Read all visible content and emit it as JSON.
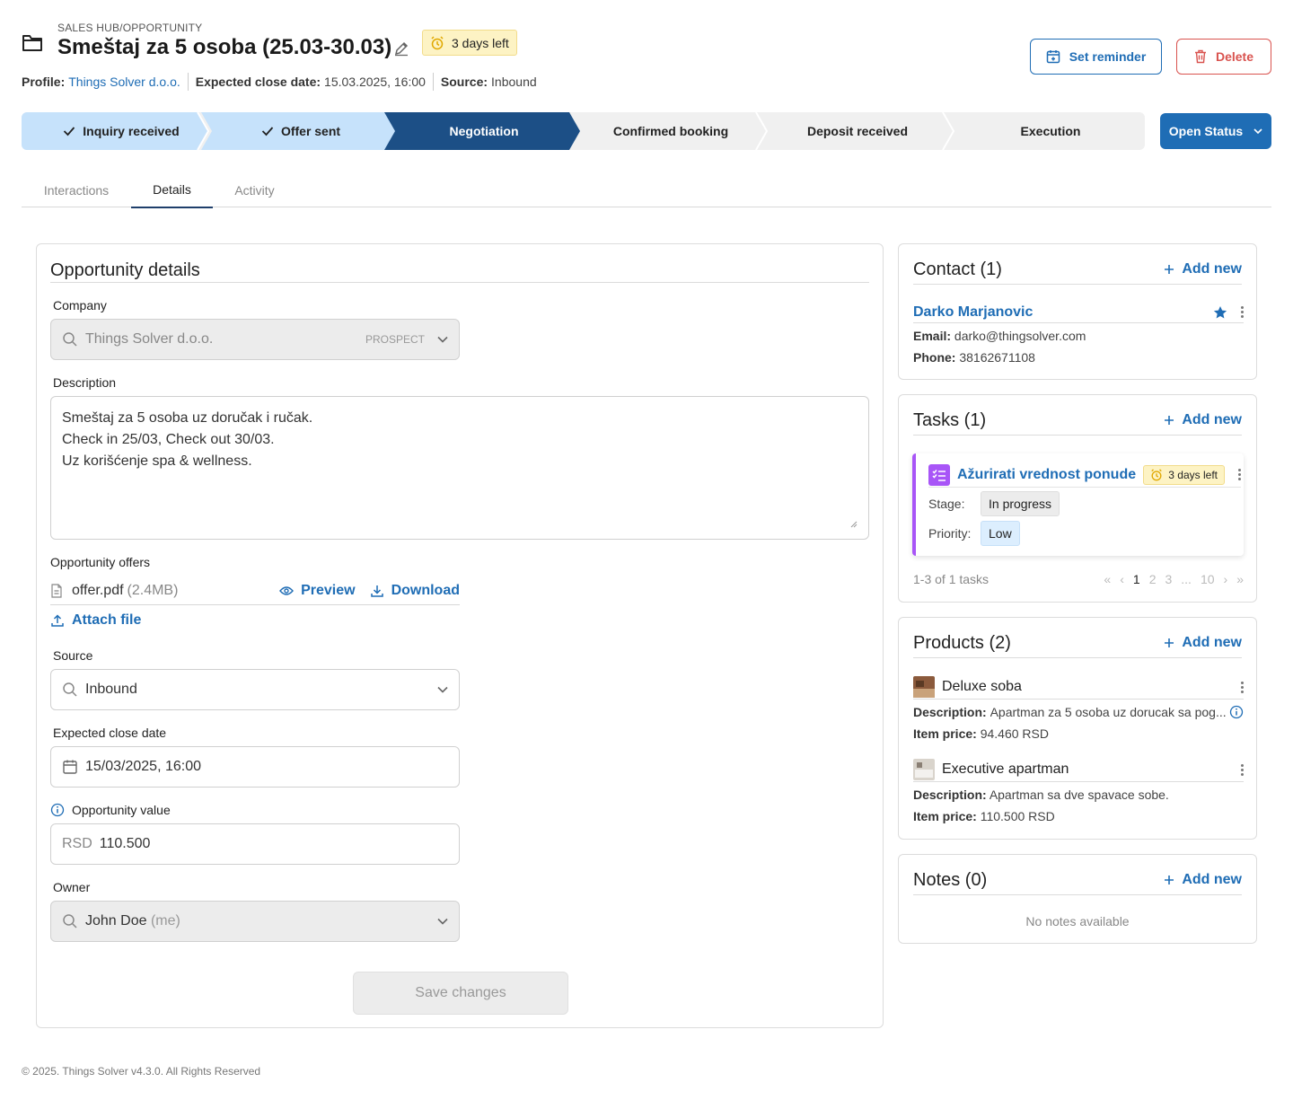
{
  "header": {
    "breadcrumb": "SALES HUB/OPPORTUNITY",
    "title": "Smeštaj za 5 osoba (25.03-30.03)",
    "days_left": "3 days left",
    "profile_label": "Profile:",
    "profile_value": "Things Solver d.o.o.",
    "close_label": "Expected close date:",
    "close_value": "15.03.2025, 16:00",
    "source_label": "Source:",
    "source_value": "Inbound",
    "set_reminder": "Set reminder",
    "delete": "Delete"
  },
  "pipeline": {
    "stages": [
      {
        "label": "Inquiry received",
        "state": "done"
      },
      {
        "label": "Offer sent",
        "state": "done"
      },
      {
        "label": "Negotiation",
        "state": "current"
      },
      {
        "label": "Confirmed booking",
        "state": "pending"
      },
      {
        "label": "Deposit received",
        "state": "pending"
      },
      {
        "label": "Execution",
        "state": "pending"
      }
    ],
    "open_status": "Open Status"
  },
  "tabs": [
    {
      "label": "Interactions",
      "active": false
    },
    {
      "label": "Details",
      "active": true
    },
    {
      "label": "Activity",
      "active": false
    }
  ],
  "details": {
    "title": "Opportunity details",
    "company_label": "Company",
    "company_value": "Things Solver d.o.o.",
    "company_tag": "PROSPECT",
    "description_label": "Description",
    "description_lines": [
      "Smeštaj za 5 osoba uz doručak i ručak.",
      "Check in 25/03, Check out 30/03.",
      "Uz korišćenje spa & wellness."
    ],
    "offers_label": "Opportunity offers",
    "offer_file": "offer.pdf",
    "offer_size": "(2.4MB)",
    "preview": "Preview",
    "download": "Download",
    "attach_file": "Attach file",
    "source_label": "Source",
    "source_value": "Inbound",
    "close_date_label": "Expected close date",
    "close_date_value": "15/03/2025, 16:00",
    "value_label": "Opportunity value",
    "value_currency": "RSD",
    "value_amount": "110.500",
    "owner_label": "Owner",
    "owner_value": "John Doe",
    "owner_suffix": "(me)",
    "save": "Save changes"
  },
  "contact": {
    "title": "Contact (1)",
    "add_new": "Add new",
    "name": "Darko Marjanovic",
    "email_label": "Email:",
    "email": "darko@thingsolver.com",
    "phone_label": "Phone:",
    "phone": "38162671108"
  },
  "tasks": {
    "title": "Tasks (1)",
    "add_new": "Add new",
    "task_name": "Ažurirati vrednost ponude",
    "task_days": "3 days left",
    "stage_label": "Stage:",
    "stage_value": "In progress",
    "priority_label": "Priority:",
    "priority_value": "Low",
    "pagination_text": "1-3 of 1 tasks",
    "pages": [
      "1",
      "2",
      "3",
      "...",
      "10"
    ]
  },
  "products": {
    "title": "Products (2)",
    "add_new": "Add new",
    "description_label": "Description:",
    "price_label": "Item price:",
    "items": [
      {
        "name": "Deluxe soba",
        "description": "Apartman za 5 osoba uz dorucak sa pog...",
        "price": "94.460 RSD"
      },
      {
        "name": "Executive apartman",
        "description": "Apartman sa dve spavace sobe.",
        "price": "110.500 RSD"
      }
    ]
  },
  "notes": {
    "title": "Notes (0)",
    "add_new": "Add new",
    "empty": "No notes available"
  },
  "footer": "© 2025. Things Solver v4.3.0. All Rights Reserved",
  "colors": {
    "primary": "#1f6db5",
    "danger": "#d9534f",
    "stage_done": "#c6e2fb",
    "stage_current": "#1c4f86",
    "stage_pending": "#f0f0f0",
    "task_accent": "#a855f7",
    "warning_bg": "#fdf3c4"
  }
}
